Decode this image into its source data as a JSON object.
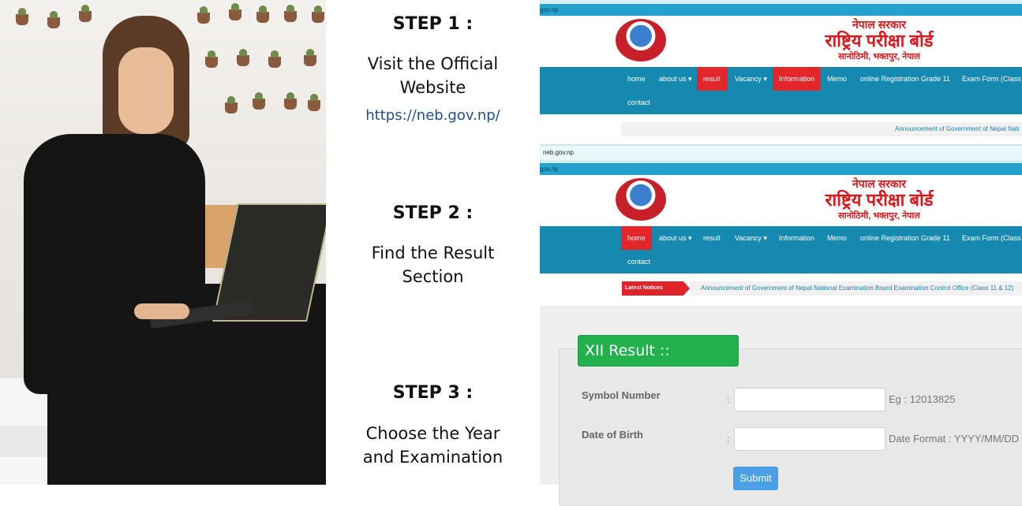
{
  "steps": [
    {
      "title": "STEP 1 :",
      "desc": [
        "Visit the Official",
        "Website"
      ],
      "link": "https://neb.gov.np/"
    },
    {
      "title": "STEP 2 :",
      "desc": [
        "Find the Result",
        "Section"
      ]
    },
    {
      "title": "STEP 3 :",
      "desc": [
        "Choose the Year",
        "and Examination"
      ]
    }
  ],
  "site": {
    "top_url": "gov.np",
    "url_bar": "neb.gov.np",
    "logo_text": [
      "नेपाल सरकार",
      "राष्ट्रिय परीक्षा बोर्ड",
      "सानोठिमी, भक्तपुर, नेपाल"
    ],
    "nav": [
      "home",
      "about us ▾",
      "result",
      "Vacancy ▾",
      "Information",
      "Memo",
      "online Registration Grade 11",
      "Exam Form (Class",
      "contact"
    ],
    "latest_notices": "Latest Notices",
    "notice_1": "Announcement of Government of Nepal Nati",
    "notice_2": "Announcement of Government of Nepal National Examination Board Examination Control Office (Class 11 & 12)"
  },
  "form": {
    "title": "XII Result ::",
    "symbol_label": "Symbol Number",
    "symbol_hint": "Eg : 12013825",
    "dob_label": "Date of Birth",
    "dob_hint": "Date Format : YYYY/MM/DD",
    "colon": ":",
    "submit": "Submit"
  },
  "colors": {
    "nav": "#1689b0",
    "active": "#e3262a",
    "form_header": "#22b14c",
    "submit": "#4a9fe6",
    "link": "#1d4f91"
  }
}
